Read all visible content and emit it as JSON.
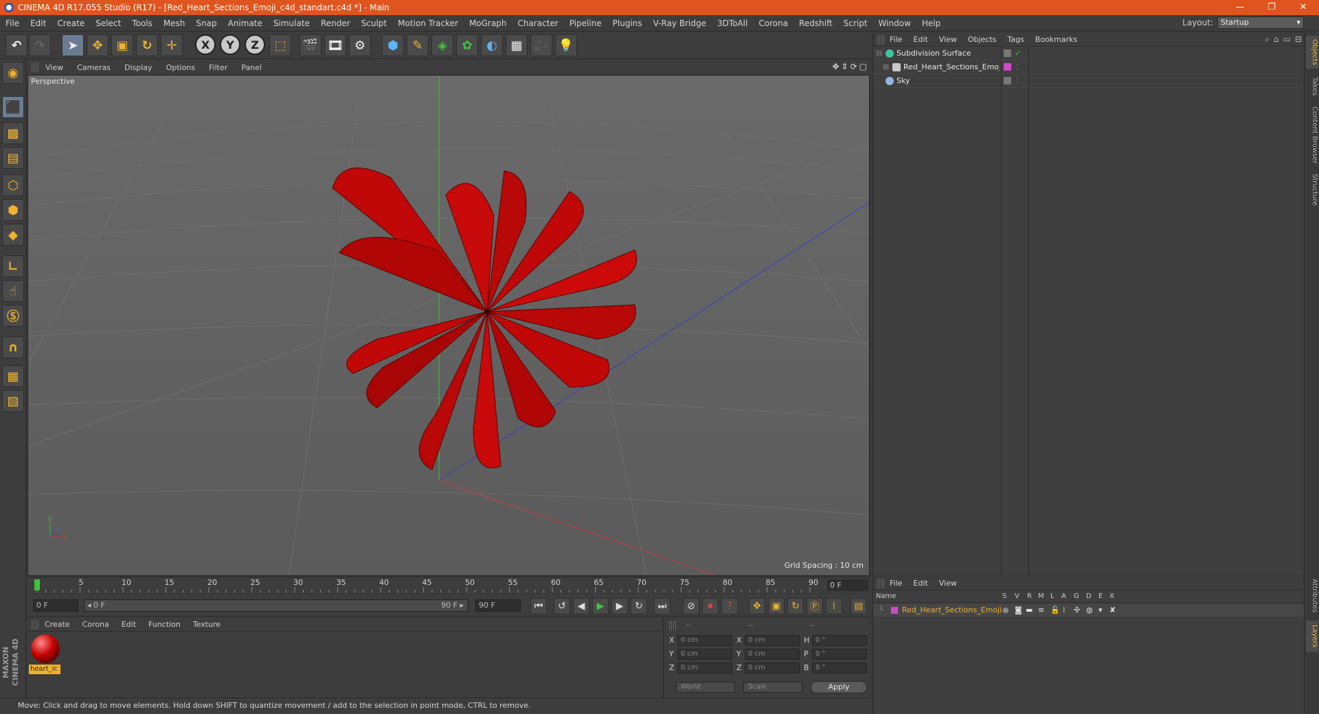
{
  "window": {
    "title": "CINEMA 4D R17.055 Studio (R17) - [Red_Heart_Sections_Emoji_c4d_standart.c4d *] - Main",
    "minimize": "—",
    "restore": "❐",
    "close": "✕"
  },
  "menu": [
    "File",
    "Edit",
    "Create",
    "Select",
    "Tools",
    "Mesh",
    "Snap",
    "Animate",
    "Simulate",
    "Render",
    "Sculpt",
    "Motion Tracker",
    "MoGraph",
    "Character",
    "Pipeline",
    "Plugins",
    "V-Ray Bridge",
    "3DToAll",
    "Corona",
    "Redshift",
    "Script",
    "Window",
    "Help"
  ],
  "layout": {
    "label": "Layout:",
    "value": "Startup"
  },
  "toolbar_icons": [
    "undo-icon",
    "redo-icon",
    "select-icon",
    "move-icon",
    "scale-icon",
    "rotate-icon",
    "live-select-icon",
    "x-axis-icon",
    "y-axis-icon",
    "z-axis-icon",
    "coordinate-system-icon",
    "render-view-icon",
    "render-picture-viewer-icon",
    "edit-render-settings-icon",
    "cube-icon",
    "pen-icon",
    "subdivision-icon",
    "cloner-icon",
    "deformer-icon",
    "floor-icon",
    "camera-icon",
    "light-icon"
  ],
  "viewport": {
    "menu": [
      "View",
      "Cameras",
      "Display",
      "Options",
      "Filter",
      "Panel"
    ],
    "label": "Perspective",
    "grid_spacing": "Grid Spacing : 10 cm",
    "axis_y": "y",
    "axis_z": "z",
    "axis_x": "x"
  },
  "timeline": {
    "ticks": [
      "0",
      "5",
      "10",
      "15",
      "20",
      "25",
      "30",
      "35",
      "40",
      "45",
      "50",
      "55",
      "60",
      "65",
      "70",
      "75",
      "80",
      "85",
      "90"
    ],
    "current_frame": "0 F"
  },
  "transport": {
    "start_field": "0 F",
    "range_start": "◂ 0 F",
    "range_end": "90 F ▸",
    "end_field": "90 F"
  },
  "materials": {
    "menu": [
      "Create",
      "Corona",
      "Edit",
      "Function",
      "Texture"
    ],
    "items": [
      {
        "name": "heart_ic"
      }
    ]
  },
  "coordinates": {
    "headers": [
      "--",
      "--",
      "--"
    ],
    "rows": [
      {
        "l1": "X",
        "v1": "0 cm",
        "l2": "X",
        "v2": "0 cm",
        "l3": "H",
        "v3": "0 °"
      },
      {
        "l1": "Y",
        "v1": "0 cm",
        "l2": "Y",
        "v2": "0 cm",
        "l3": "P",
        "v3": "0 °"
      },
      {
        "l1": "Z",
        "v1": "0 cm",
        "l2": "Z",
        "v2": "0 cm",
        "l3": "B",
        "v3": "0 °"
      }
    ],
    "mode1": "World",
    "mode2": "Scale",
    "apply": "Apply"
  },
  "status": "Move: Click and drag to move elements. Hold down SHIFT to quantize movement / add to the selection in point mode, CTRL to remove.",
  "objects": {
    "menu": [
      "File",
      "Edit",
      "View",
      "Objects",
      "Tags",
      "Bookmarks"
    ],
    "rows": [
      {
        "name": "Subdivision Surface",
        "icon_color": "#3ec3a0"
      },
      {
        "name": "Red_Heart_Sections_Emoji",
        "icon_color": "#c8c8c8"
      },
      {
        "name": "Sky",
        "icon_color": "#8fb6e6"
      }
    ]
  },
  "layers": {
    "menu": [
      "File",
      "Edit",
      "View"
    ],
    "columns": [
      "Name",
      "S",
      "V",
      "R",
      "M",
      "L",
      "A",
      "G",
      "D",
      "E",
      "X"
    ],
    "rows": [
      {
        "name": "Red_Heart_Sections_Emoji",
        "color": "#d04ac8"
      }
    ]
  },
  "side_tabs": [
    "Objects",
    "Takes",
    "Content Browser",
    "Structure",
    "Attributes",
    "Layers"
  ],
  "colors": {
    "accent": "#f0b22d",
    "title_bar": "#e0541e",
    "model": "#cc0a0a"
  }
}
